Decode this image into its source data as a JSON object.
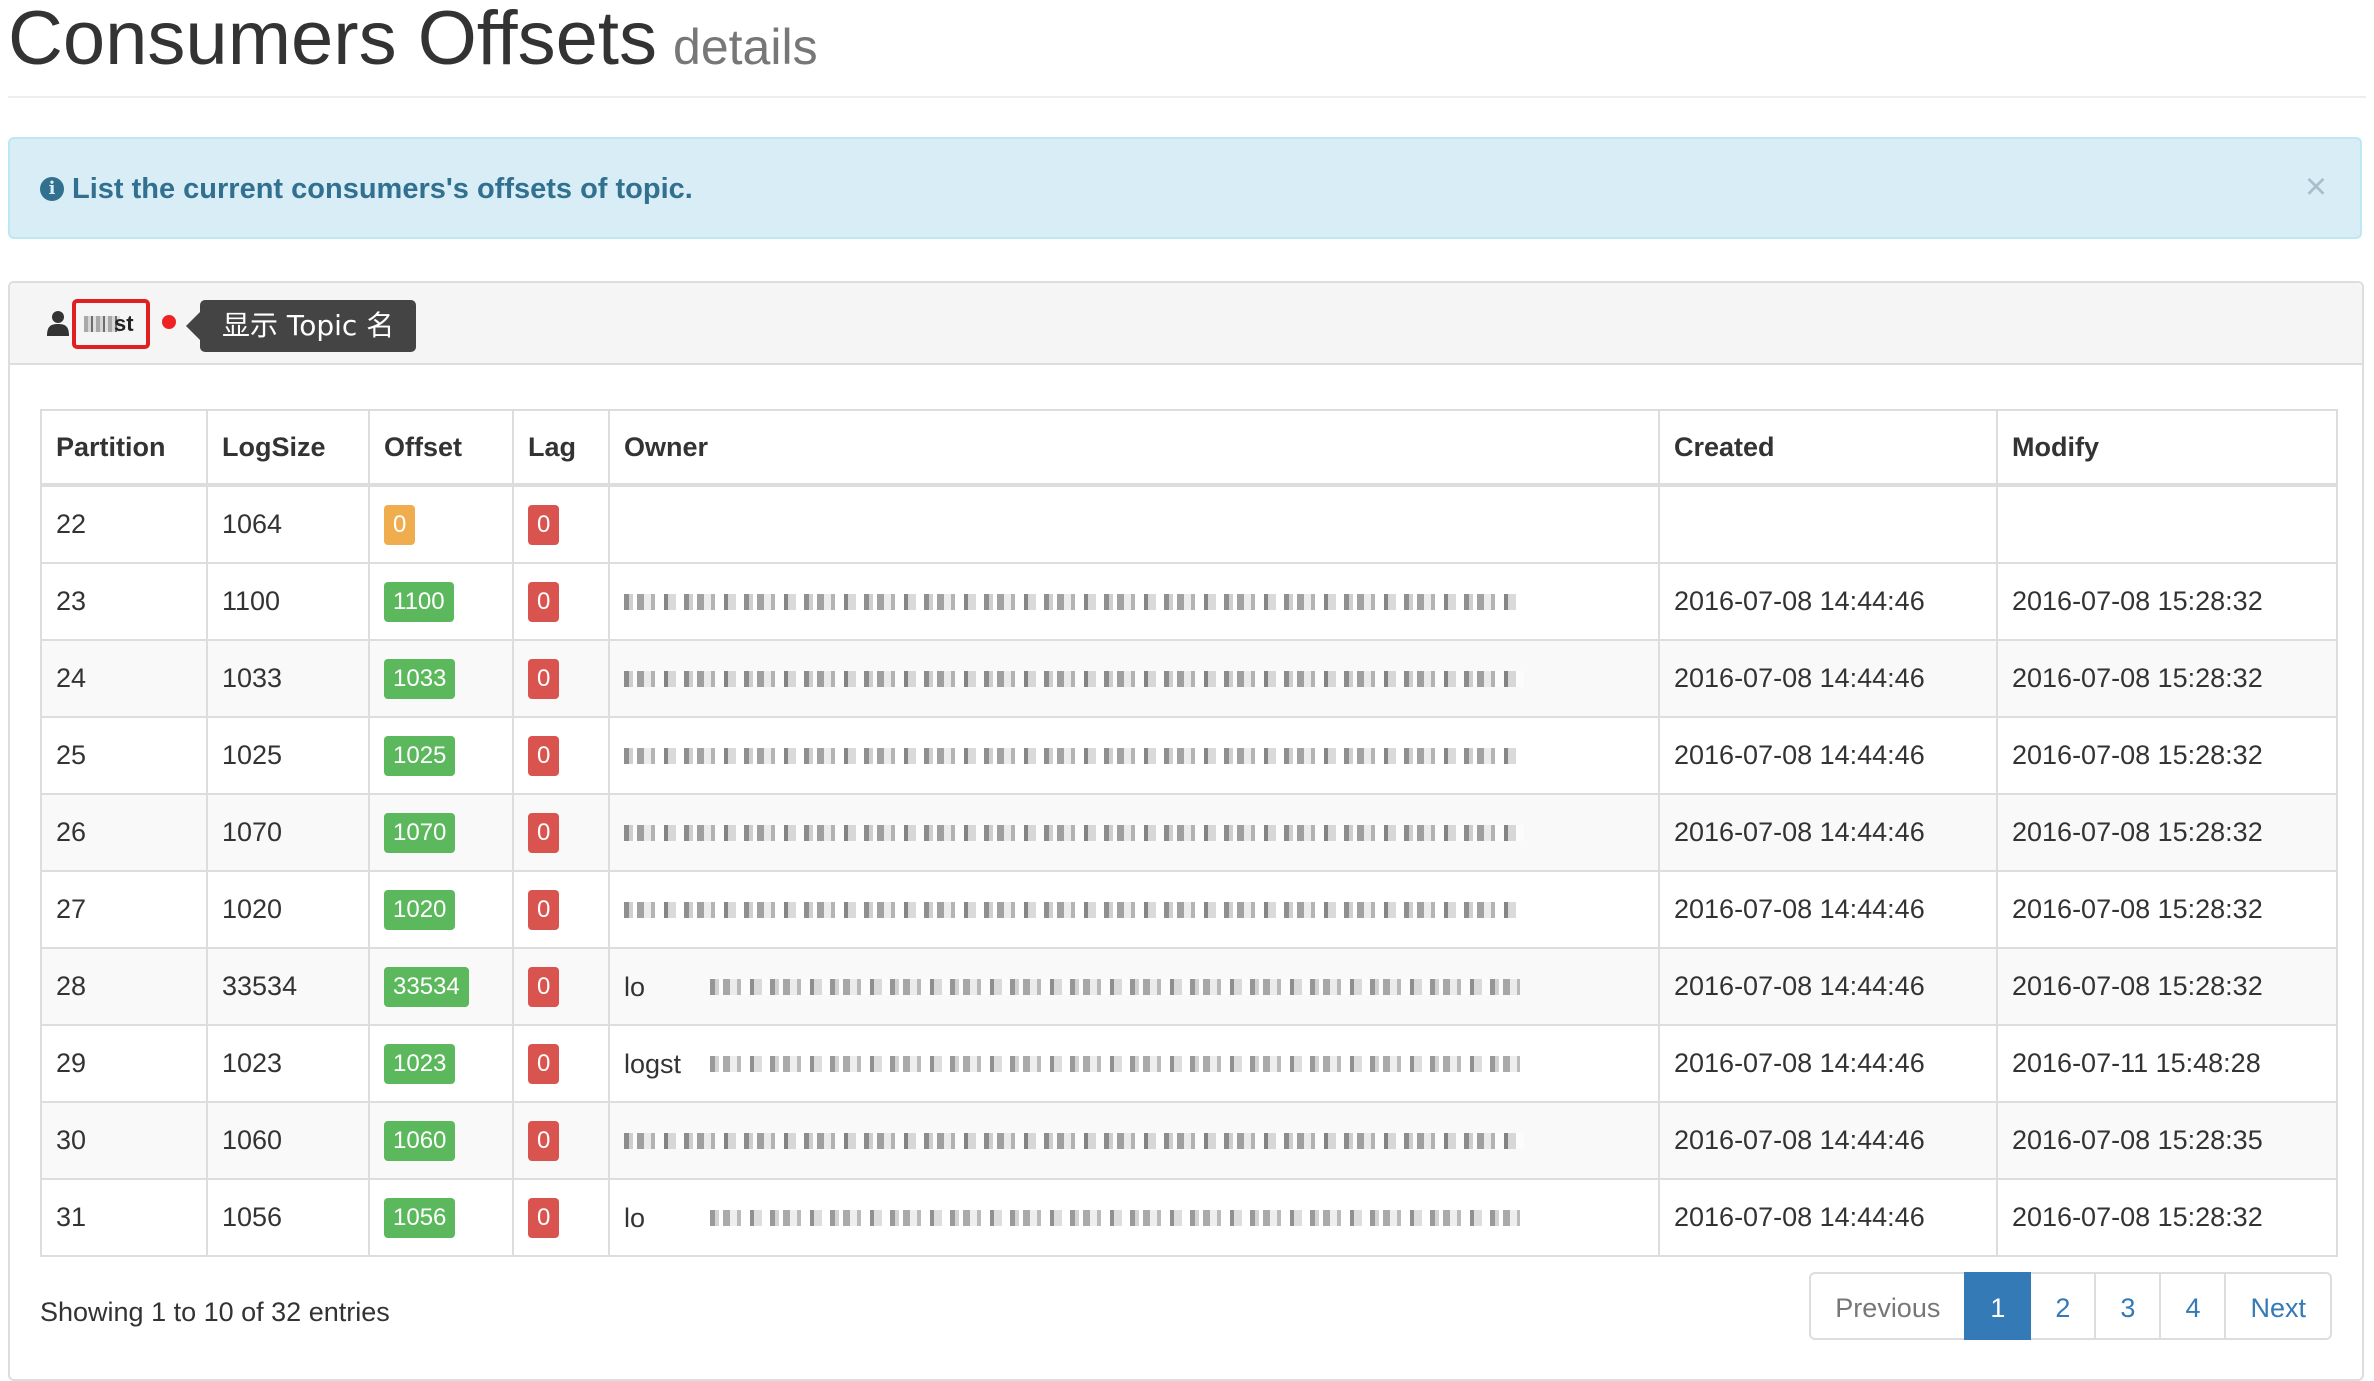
{
  "header": {
    "title": "Consumers Offsets",
    "subtitle": "details"
  },
  "alert": {
    "text": "List the current consumers's offsets of topic.",
    "close_label": "×"
  },
  "panel": {
    "topic_label": "st",
    "tooltip": "显示 Topic 名"
  },
  "table": {
    "headers": [
      "Partition",
      "LogSize",
      "Offset",
      "Lag",
      "Owner",
      "Created",
      "Modify"
    ],
    "rows": [
      {
        "partition": "22",
        "logsize": "1064",
        "offset": "0",
        "offset_status": "warning",
        "lag": "0",
        "owner": "",
        "created": "",
        "modify": ""
      },
      {
        "partition": "23",
        "logsize": "1100",
        "offset": "1100",
        "offset_status": "success",
        "lag": "0",
        "owner": "",
        "created": "2016-07-08 14:44:46",
        "modify": "2016-07-08 15:28:32"
      },
      {
        "partition": "24",
        "logsize": "1033",
        "offset": "1033",
        "offset_status": "success",
        "lag": "0",
        "owner": "",
        "created": "2016-07-08 14:44:46",
        "modify": "2016-07-08 15:28:32"
      },
      {
        "partition": "25",
        "logsize": "1025",
        "offset": "1025",
        "offset_status": "success",
        "lag": "0",
        "owner": "",
        "created": "2016-07-08 14:44:46",
        "modify": "2016-07-08 15:28:32"
      },
      {
        "partition": "26",
        "logsize": "1070",
        "offset": "1070",
        "offset_status": "success",
        "lag": "0",
        "owner": "",
        "created": "2016-07-08 14:44:46",
        "modify": "2016-07-08 15:28:32"
      },
      {
        "partition": "27",
        "logsize": "1020",
        "offset": "1020",
        "offset_status": "success",
        "lag": "0",
        "owner": "",
        "created": "2016-07-08 14:44:46",
        "modify": "2016-07-08 15:28:32"
      },
      {
        "partition": "28",
        "logsize": "33534",
        "offset": "33534",
        "offset_status": "success",
        "lag": "0",
        "owner": "lo",
        "created": "2016-07-08 14:44:46",
        "modify": "2016-07-08 15:28:32"
      },
      {
        "partition": "29",
        "logsize": "1023",
        "offset": "1023",
        "offset_status": "success",
        "lag": "0",
        "owner": "logst",
        "created": "2016-07-08 14:44:46",
        "modify": "2016-07-11 15:48:28"
      },
      {
        "partition": "30",
        "logsize": "1060",
        "offset": "1060",
        "offset_status": "success",
        "lag": "0",
        "owner": "",
        "created": "2016-07-08 14:44:46",
        "modify": "2016-07-08 15:28:35"
      },
      {
        "partition": "31",
        "logsize": "1056",
        "offset": "1056",
        "offset_status": "success",
        "lag": "0",
        "owner": "lo",
        "created": "2016-07-08 14:44:46",
        "modify": "2016-07-08 15:28:32"
      }
    ]
  },
  "footer": {
    "info": "Showing 1 to 10 of 32 entries",
    "pagination": {
      "previous": "Previous",
      "pages": [
        "1",
        "2",
        "3",
        "4"
      ],
      "active_page": "1",
      "next": "Next"
    }
  },
  "colors": {
    "alert_bg": "#d9edf7",
    "alert_text": "#31708f",
    "label_success": "#5cb85c",
    "label_warning": "#f0ad4e",
    "label_danger": "#d9534f",
    "link": "#337ab7",
    "tooltip_bg": "#444444"
  },
  "icons": [
    "info-circle-icon",
    "close-icon",
    "user-icon"
  ]
}
